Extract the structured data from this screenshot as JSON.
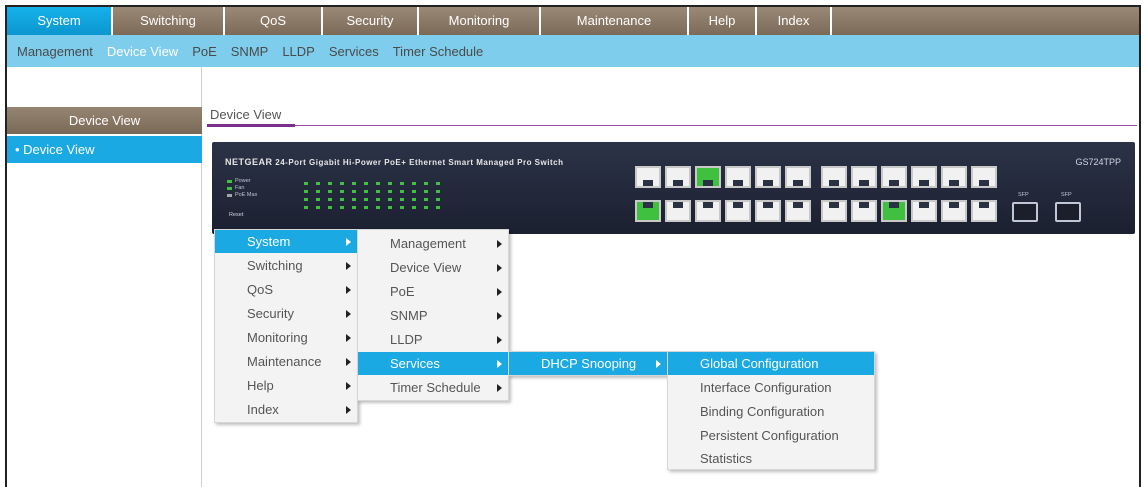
{
  "topnav": {
    "tabs": [
      {
        "label": "System",
        "active": true
      },
      {
        "label": "Switching",
        "active": false
      },
      {
        "label": "QoS",
        "active": false
      },
      {
        "label": "Security",
        "active": false
      },
      {
        "label": "Monitoring",
        "active": false
      },
      {
        "label": "Maintenance",
        "active": false
      },
      {
        "label": "Help",
        "active": false
      },
      {
        "label": "Index",
        "active": false
      }
    ]
  },
  "subnav": {
    "items": [
      {
        "label": "Management",
        "active": false
      },
      {
        "label": "Device View",
        "active": true
      },
      {
        "label": "PoE",
        "active": false
      },
      {
        "label": "SNMP",
        "active": false
      },
      {
        "label": "LLDP",
        "active": false
      },
      {
        "label": "Services",
        "active": false
      },
      {
        "label": "Timer Schedule",
        "active": false
      }
    ]
  },
  "sidebar": {
    "header": "Device View",
    "items": [
      {
        "label": "• Device View",
        "selected": true
      }
    ]
  },
  "main": {
    "title": "Device View"
  },
  "device": {
    "brand": "NETGEAR",
    "description": "24-Port Gigabit Hi-Power PoE+ Ethernet Smart Managed Pro Switch",
    "model": "GS724TPP",
    "led_power": "Power",
    "led_fan": "Fan",
    "led_poe_max": "PoE Max",
    "reset": "Reset",
    "sfp_label": "SFP",
    "active_ports": [
      5,
      2,
      18
    ]
  },
  "menus": {
    "level1": [
      {
        "label": "System",
        "selected": true
      },
      {
        "label": "Switching",
        "selected": false
      },
      {
        "label": "QoS",
        "selected": false
      },
      {
        "label": "Security",
        "selected": false
      },
      {
        "label": "Monitoring",
        "selected": false
      },
      {
        "label": "Maintenance",
        "selected": false
      },
      {
        "label": "Help",
        "selected": false
      },
      {
        "label": "Index",
        "selected": false
      }
    ],
    "level2": [
      {
        "label": "Management",
        "selected": false
      },
      {
        "label": "Device View",
        "selected": false
      },
      {
        "label": "PoE",
        "selected": false
      },
      {
        "label": "SNMP",
        "selected": false
      },
      {
        "label": "LLDP",
        "selected": false
      },
      {
        "label": "Services",
        "selected": true
      },
      {
        "label": "Timer Schedule",
        "selected": false
      }
    ],
    "level3": [
      {
        "label": "DHCP Snooping",
        "selected": true
      }
    ],
    "level4": [
      {
        "label": "Global Configuration",
        "selected": true
      },
      {
        "label": "Interface Configuration",
        "selected": false
      },
      {
        "label": "Binding Configuration",
        "selected": false
      },
      {
        "label": "Persistent Configuration",
        "selected": false
      },
      {
        "label": "Statistics",
        "selected": false
      }
    ]
  },
  "colors": {
    "accent": "#1aa9e3",
    "nav_brown": "#8c7b6a",
    "subnav_blue": "#7fcdec",
    "port_active": "#3fc03f"
  }
}
